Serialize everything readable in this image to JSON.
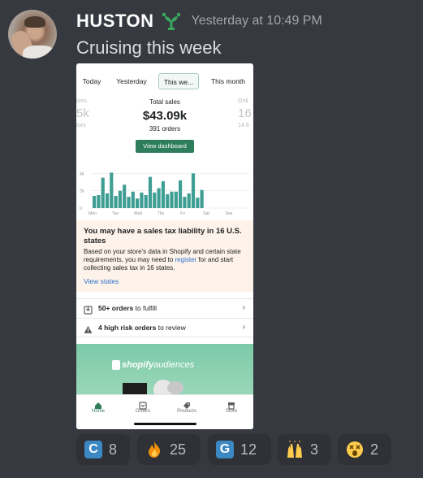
{
  "message": {
    "username": "HUSTON",
    "badge_icon": "sprout-badge-icon",
    "timestamp": "Yesterday at 10:49 PM",
    "text": "Cruising this week"
  },
  "screenshot": {
    "tabs": [
      {
        "label": "Today",
        "active": false
      },
      {
        "label": "Yesterday",
        "active": false
      },
      {
        "label": "This we...",
        "active": true
      },
      {
        "label": "This month",
        "active": false
      }
    ],
    "stats": {
      "left": {
        "label": "ions",
        "value": "5k",
        "sub": "tors"
      },
      "main": {
        "label": "Total sales",
        "value": "$43.09k",
        "sub": "391 orders"
      },
      "right": {
        "label": "Onli",
        "value": "16",
        "sub": "14.6"
      }
    },
    "view_dashboard_label": "View dashboard",
    "chart": {
      "y_ticks": [
        "4k",
        "2k",
        "0"
      ],
      "x_labels": [
        "Mon",
        "Tue",
        "Wed",
        "Thu",
        "Fri",
        "Sat",
        "Sun"
      ]
    },
    "tax_notice": {
      "title": "You may have a sales tax liability in 16 U.S. states",
      "body_before_link": "Based on your store's data in Shopify and certain state requirements, you may need to ",
      "link": "register",
      "body_after_link": " for and start collecting sales tax in 16 states.",
      "cta": "View states"
    },
    "tasks": [
      {
        "bold": "50+ orders",
        "rest": " to fulfill",
        "icon": "inbox-icon"
      },
      {
        "bold": "4 high risk orders",
        "rest": " to review",
        "icon": "warning-icon"
      }
    ],
    "banner": {
      "brand": "shopify",
      "suffix": "audiences"
    },
    "nav": [
      {
        "label": "Home",
        "icon": "home-icon",
        "active": true
      },
      {
        "label": "Orders",
        "icon": "orders-icon",
        "active": false
      },
      {
        "label": "Products",
        "icon": "tag-icon",
        "active": false
      },
      {
        "label": "Store",
        "icon": "store-icon",
        "active": false
      }
    ]
  },
  "reactions": [
    {
      "emoji": "C",
      "kind": "letter",
      "color": "#3b88c3",
      "count": "8"
    },
    {
      "emoji": "fire",
      "kind": "fire",
      "count": "25"
    },
    {
      "emoji": "G",
      "kind": "letter",
      "color": "#3b88c3",
      "count": "12"
    },
    {
      "emoji": "raising-hands",
      "kind": "hands",
      "count": "3"
    },
    {
      "emoji": "dizzy-face",
      "kind": "dizzy",
      "count": "2"
    }
  ],
  "chart_data": {
    "type": "bar",
    "categories": [
      "Mon",
      "Tue",
      "Wed",
      "Thu",
      "Fri",
      "Sat",
      "Sun"
    ],
    "values": [
      1400,
      1500,
      3500,
      1700,
      4100,
      1400,
      2000,
      2700,
      1300,
      1900,
      1100,
      1800,
      1500,
      3600,
      1800,
      2300,
      3100,
      1600,
      1900,
      1900,
      3200,
      1300,
      1700,
      4000,
      1200,
      2100
    ],
    "ylim": [
      0,
      4500
    ],
    "y_tick_labels": [
      "4k",
      "2k",
      "0"
    ],
    "grid": true,
    "legend": "none"
  }
}
